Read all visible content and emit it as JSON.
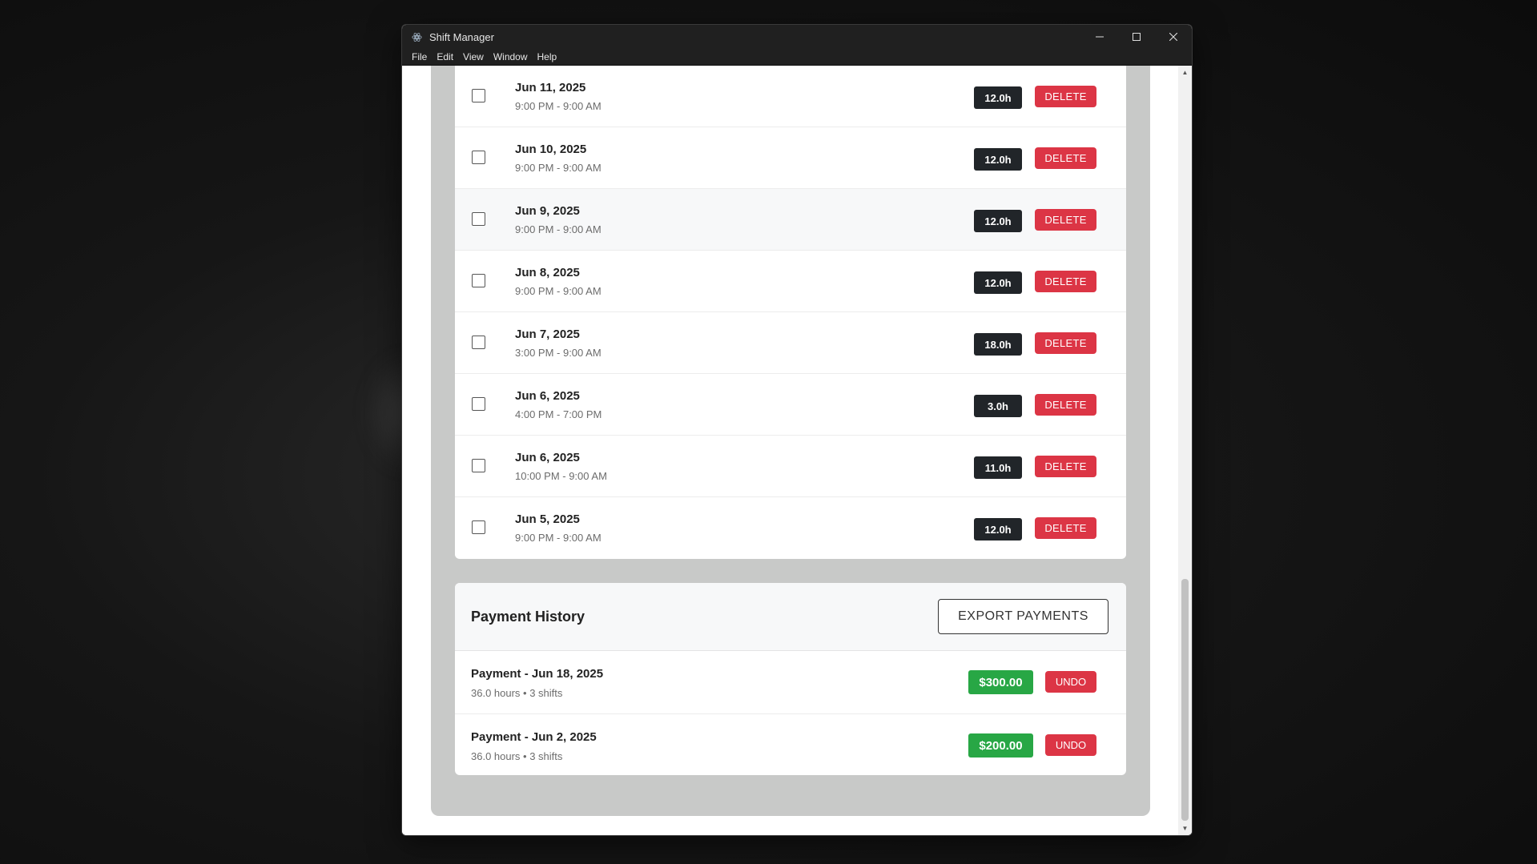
{
  "window": {
    "title": "Shift Manager"
  },
  "menu": [
    "File",
    "Edit",
    "View",
    "Window",
    "Help"
  ],
  "shifts": [
    {
      "date": "Jun 11, 2025",
      "time": "9:00 PM - 9:00 AM",
      "hours": "12.0h",
      "action": "DELETE"
    },
    {
      "date": "Jun 10, 2025",
      "time": "9:00 PM - 9:00 AM",
      "hours": "12.0h",
      "action": "DELETE"
    },
    {
      "date": "Jun 9, 2025",
      "time": "9:00 PM - 9:00 AM",
      "hours": "12.0h",
      "action": "DELETE"
    },
    {
      "date": "Jun 8, 2025",
      "time": "9:00 PM - 9:00 AM",
      "hours": "12.0h",
      "action": "DELETE"
    },
    {
      "date": "Jun 7, 2025",
      "time": "3:00 PM - 9:00 AM",
      "hours": "18.0h",
      "action": "DELETE"
    },
    {
      "date": "Jun 6, 2025",
      "time": "4:00 PM - 7:00 PM",
      "hours": "3.0h",
      "action": "DELETE"
    },
    {
      "date": "Jun 6, 2025",
      "time": "10:00 PM - 9:00 AM",
      "hours": "11.0h",
      "action": "DELETE"
    },
    {
      "date": "Jun 5, 2025",
      "time": "9:00 PM - 9:00 AM",
      "hours": "12.0h",
      "action": "DELETE"
    }
  ],
  "payment_history": {
    "title": "Payment History",
    "export_label": "EXPORT PAYMENTS",
    "payments": [
      {
        "label": "Payment - Jun 18, 2025",
        "meta": "36.0 hours • 3 shifts",
        "amount": "$300.00",
        "action": "UNDO"
      },
      {
        "label": "Payment - Jun 2, 2025",
        "meta": "36.0 hours • 3 shifts",
        "amount": "$200.00",
        "action": "UNDO"
      }
    ]
  },
  "colors": {
    "delete": "#dc3545",
    "hours_badge": "#212529",
    "amount_badge": "#28a745",
    "panel_bg": "#c8c9c8"
  }
}
